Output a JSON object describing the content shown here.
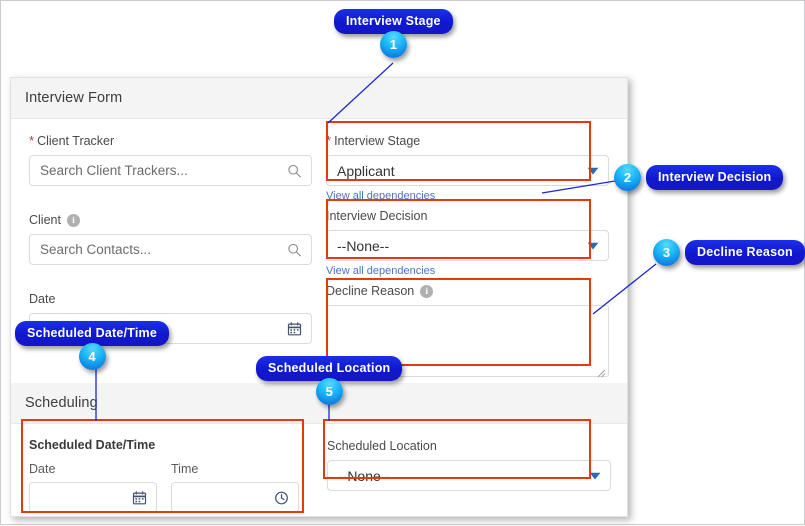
{
  "form": {
    "sections": [
      {
        "title": "Interview Form"
      },
      {
        "title": "Scheduling"
      }
    ],
    "fields": {
      "client_tracker": {
        "label": "Client Tracker",
        "required_marker": "*",
        "placeholder": "Search Client Trackers...",
        "icon": "search-icon"
      },
      "client": {
        "label": "Client",
        "placeholder": "Search Contacts...",
        "icon": "search-icon",
        "info_glyph": "i"
      },
      "date_left": {
        "label": "Date",
        "value": "",
        "icon": "calendar-icon"
      },
      "interview_stage": {
        "label": "Interview Stage",
        "required_marker": "*",
        "value": "Applicant",
        "dependency_link": "View all dependencies",
        "icon": "chevron-down-icon"
      },
      "interview_decision": {
        "label": "Interview Decision",
        "value": "--None--",
        "dependency_link": "View all dependencies",
        "icon": "chevron-down-icon"
      },
      "decline_reason": {
        "label": "Decline Reason",
        "value": "",
        "info_glyph": "i"
      },
      "scheduled_date_time": {
        "group_label": "Scheduled Date/Time",
        "date_label": "Date",
        "date_value": "",
        "date_icon": "calendar-icon",
        "time_label": "Time",
        "time_value": "",
        "time_icon": "clock-icon"
      },
      "scheduled_location": {
        "label": "Scheduled Location",
        "value": "--None--",
        "icon": "chevron-down-icon"
      }
    }
  },
  "callouts": [
    {
      "number": "1",
      "label": "Interview Stage"
    },
    {
      "number": "2",
      "label": "Interview Decision"
    },
    {
      "number": "3",
      "label": "Decline Reason"
    },
    {
      "number": "4",
      "label": "Scheduled Date/Time"
    },
    {
      "number": "5",
      "label": "Scheduled Location"
    }
  ],
  "colors": {
    "highlight": "#e8380d",
    "callout_tag": "#1616c4",
    "callout_badge": "#19b6f5",
    "required": "#c23934",
    "link": "#4a73c8"
  }
}
